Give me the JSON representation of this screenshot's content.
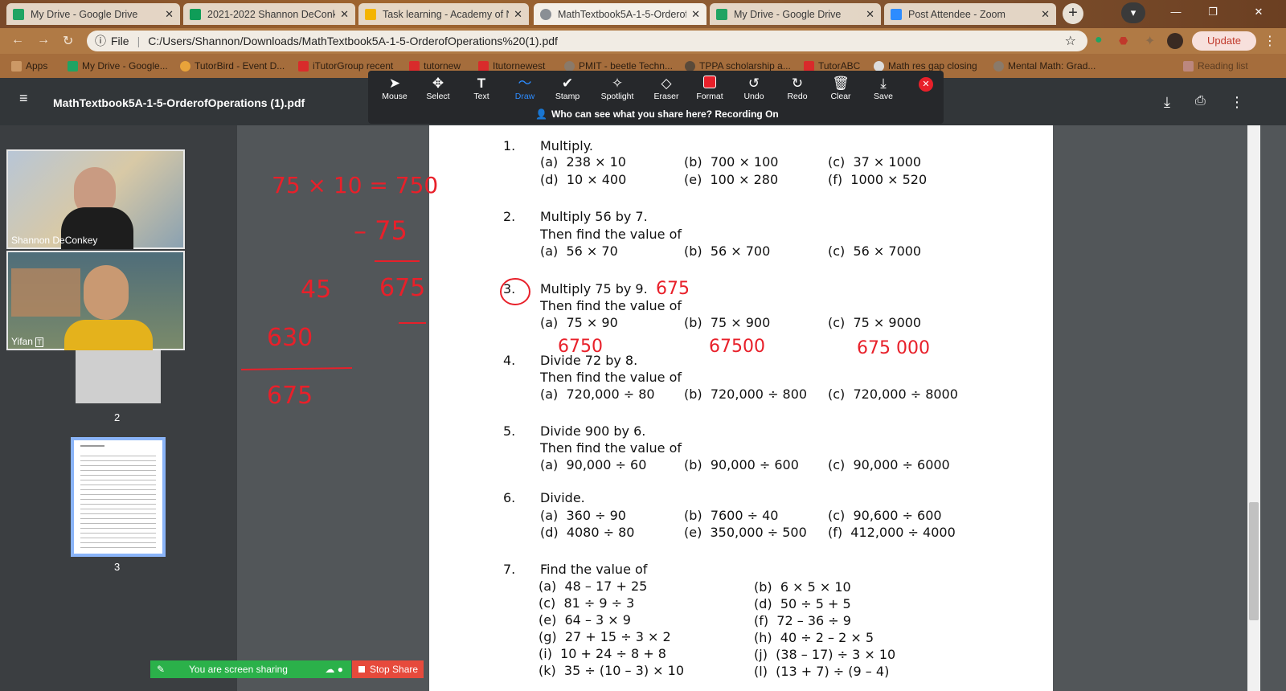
{
  "tabs": [
    {
      "title": "My Drive - Google Drive",
      "color": "#1fa463"
    },
    {
      "title": "2021-2022 Shannon DeConke",
      "color": "#0f9d58"
    },
    {
      "title": "Task learning - Academy of N",
      "color": "#f4b400"
    },
    {
      "title": "MathTextbook5A-1-5-Orderof",
      "color": "#8a8f95"
    },
    {
      "title": "My Drive - Google Drive",
      "color": "#1fa463"
    },
    {
      "title": "Post Attendee - Zoom",
      "color": "#2d8cff"
    }
  ],
  "address": {
    "url": "C:/Users/Shannon/Downloads/MathTextbook5A-1-5-OrderofOperations%20(1).pdf",
    "scheme": "File"
  },
  "update_label": "Update",
  "bookmarks": [
    "Apps",
    "My Drive - Google...",
    "TutorBird - Event D...",
    "iTutorGroup recent",
    "tutornew",
    "Itutornewest",
    "PMIT - beetle Techn...",
    "TPPA scholarship a...",
    "TutorABC",
    "Math res gap closing",
    "Mental Math: Grad...",
    "Reading list"
  ],
  "pdf": {
    "title": "MathTextbook5A-1-5-OrderofOperations (1).pdf"
  },
  "zoom_toolbar": {
    "tools": [
      "Mouse",
      "Select",
      "Text",
      "Draw",
      "Stamp",
      "Spotlight",
      "Eraser",
      "Format",
      "Undo",
      "Redo",
      "Clear",
      "Save"
    ],
    "active": "Draw",
    "recording": "Who can see what you share here? Recording On"
  },
  "participants": [
    "Shannon DeConkey",
    "Yifan"
  ],
  "thumbnails": [
    {
      "label": "2"
    },
    {
      "label": "3"
    }
  ],
  "share_bar": {
    "status": "You are screen sharing",
    "stop": "Stop Share"
  },
  "questions": [
    {
      "num": "1.",
      "lines": [
        "Multiply."
      ],
      "parts": [
        [
          "(a)",
          "238 × 10"
        ],
        [
          "(b)",
          "700 × 100"
        ],
        [
          "(c)",
          "37 × 1000"
        ],
        [
          "(d)",
          "10 × 400"
        ],
        [
          "(e)",
          "100 × 280"
        ],
        [
          "(f)",
          "1000 × 520"
        ]
      ]
    },
    {
      "num": "2.",
      "lines": [
        "Multiply 56 by 7.",
        "Then find the value of"
      ],
      "parts": [
        [
          "(a)",
          "56 × 70"
        ],
        [
          "(b)",
          "56 × 700"
        ],
        [
          "(c)",
          "56 × 7000"
        ]
      ]
    },
    {
      "num": "3.",
      "lines": [
        "Multiply 75 by 9.",
        "Then find the value of"
      ],
      "parts": [
        [
          "(a)",
          "75 × 90"
        ],
        [
          "(b)",
          "75 × 900"
        ],
        [
          "(c)",
          "75 × 9000"
        ]
      ]
    },
    {
      "num": "4.",
      "lines": [
        "Divide 72 by 8.",
        "Then find the value of"
      ],
      "parts": [
        [
          "(a)",
          "720,000 ÷ 80"
        ],
        [
          "(b)",
          "720,000 ÷ 800"
        ],
        [
          "(c)",
          "720,000 ÷ 8000"
        ]
      ]
    },
    {
      "num": "5.",
      "lines": [
        "Divide 900 by 6.",
        "Then find the value of"
      ],
      "parts": [
        [
          "(a)",
          "90,000 ÷ 60"
        ],
        [
          "(b)",
          "90,000 ÷ 600"
        ],
        [
          "(c)",
          "90,000 ÷ 6000"
        ]
      ]
    },
    {
      "num": "6.",
      "lines": [
        "Divide."
      ],
      "parts": [
        [
          "(a)",
          "360 ÷ 90"
        ],
        [
          "(b)",
          "7600 ÷ 40"
        ],
        [
          "(c)",
          "90,600 ÷ 600"
        ],
        [
          "(d)",
          "4080 ÷ 80"
        ],
        [
          "(e)",
          "350,000 ÷ 500"
        ],
        [
          "(f)",
          "412,000 ÷ 4000"
        ]
      ]
    },
    {
      "num": "7.",
      "lines": [
        "Find the value of"
      ],
      "parts": [
        [
          "(a)",
          "48 – 17 + 25"
        ],
        [
          "(b)",
          "6 × 5 × 10"
        ],
        [
          "(c)",
          "81 ÷ 9 ÷ 3"
        ],
        [
          "(d)",
          "50 ÷ 5 + 5"
        ],
        [
          "(e)",
          "64 – 3 × 9"
        ],
        [
          "(f)",
          "72 – 36 ÷ 9"
        ],
        [
          "(g)",
          "27 + 15 ÷ 3 × 2"
        ],
        [
          "(h)",
          "40 ÷ 2 – 2 × 5"
        ],
        [
          "(i)",
          "10 + 24 ÷ 8 + 8"
        ],
        [
          "(j)",
          "(38 – 17) ÷ 3 × 10"
        ],
        [
          "(k)",
          "35 ÷ (10 – 3) × 10"
        ],
        [
          "(l)",
          "(13 + 7) ÷ (9 – 4)"
        ]
      ]
    }
  ],
  "annotations": {
    "left": [
      "75 × 10 = 750",
      "– 75",
      "675",
      "45",
      "630",
      "675"
    ],
    "page": [
      "675",
      "6750",
      "67500",
      "675 000"
    ]
  },
  "colors": {
    "ink": "#e8202a",
    "share_green": "#2bb14a",
    "stop_red": "#e64a3c"
  }
}
